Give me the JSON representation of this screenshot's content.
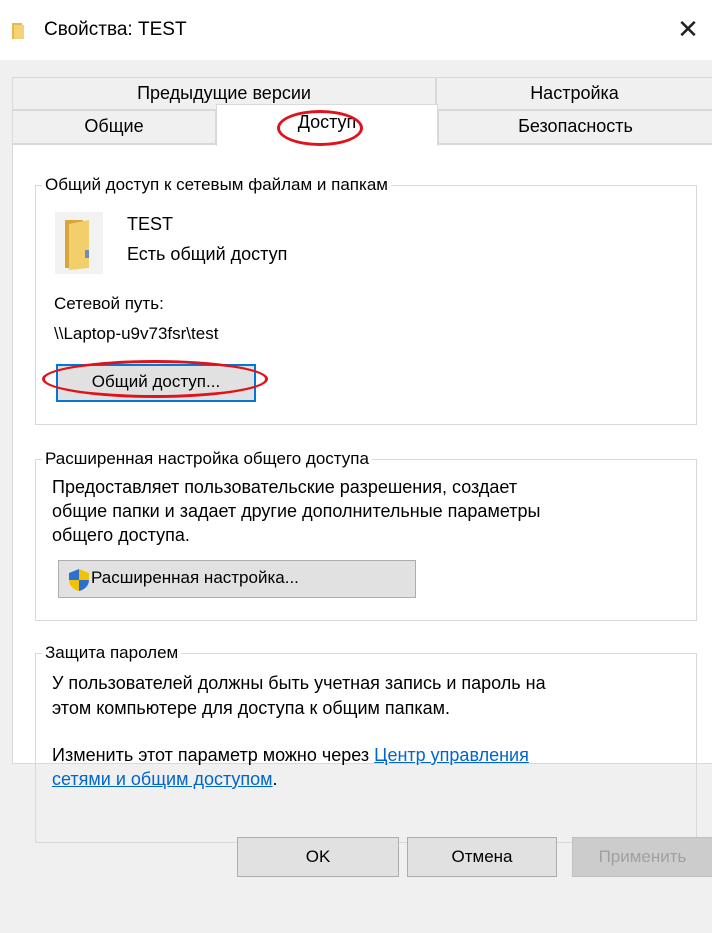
{
  "window": {
    "title": "Свойства: TEST",
    "close_label": "✕"
  },
  "tabs": {
    "previous_versions": "Предыдущие версии",
    "customize": "Настройка",
    "general": "Общие",
    "sharing": "Доступ",
    "security": "Безопасность",
    "active": "Доступ"
  },
  "network_sharing": {
    "caption": "Общий доступ к сетевым файлам и папкам",
    "folder_name": "TEST",
    "status": "Есть общий доступ",
    "network_path_label": "Сетевой путь:",
    "network_path": "\\\\Laptop-u9v73fsr\\test",
    "share_button": "Общий доступ..."
  },
  "advanced_sharing": {
    "caption": "Расширенная настройка общего доступа",
    "description_lines": [
      "Предоставляет пользовательские разрешения, создает",
      "общие папки и задает другие дополнительные параметры",
      "общего доступа."
    ],
    "button": "Расширенная настройка..."
  },
  "password_protection": {
    "caption": "Защита паролем",
    "description_lines": [
      "У пользователей должны быть учетная запись и пароль на",
      "этом компьютере для доступа к общим папкам."
    ],
    "change_text": "Изменить этот параметр можно через ",
    "link_line1": "Центр управления",
    "link_line2": "сетями и общим доступом",
    "link_suffix": "."
  },
  "footer": {
    "ok": "OK",
    "cancel": "Отмена",
    "apply": "Применить"
  },
  "colors": {
    "folder": "#e8b84a",
    "link": "#0066cc",
    "annotation": "#e0121b",
    "focus_border": "#0078d7"
  }
}
